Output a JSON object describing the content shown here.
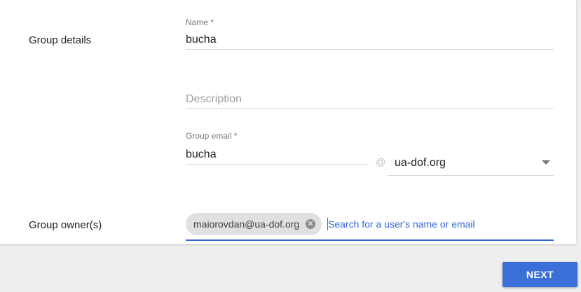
{
  "group_details": {
    "section_label": "Group details",
    "name": {
      "label": "Name *",
      "value": "bucha"
    },
    "description": {
      "placeholder": "Description"
    },
    "email": {
      "label": "Group email *",
      "value": "bucha",
      "at_symbol": "@",
      "domain": "ua-dof.org"
    }
  },
  "group_owners": {
    "section_label": "Group owner(s)",
    "chips": [
      {
        "label": "maiorovdan@ua-dof.org",
        "remove_glyph": "✕"
      }
    ],
    "search_placeholder": "Search for a user's name or email"
  },
  "actions": {
    "next_label": "NEXT"
  },
  "colors": {
    "accent": "#3367d6",
    "button": "#3b6fd8",
    "background": "#eeeeee"
  }
}
